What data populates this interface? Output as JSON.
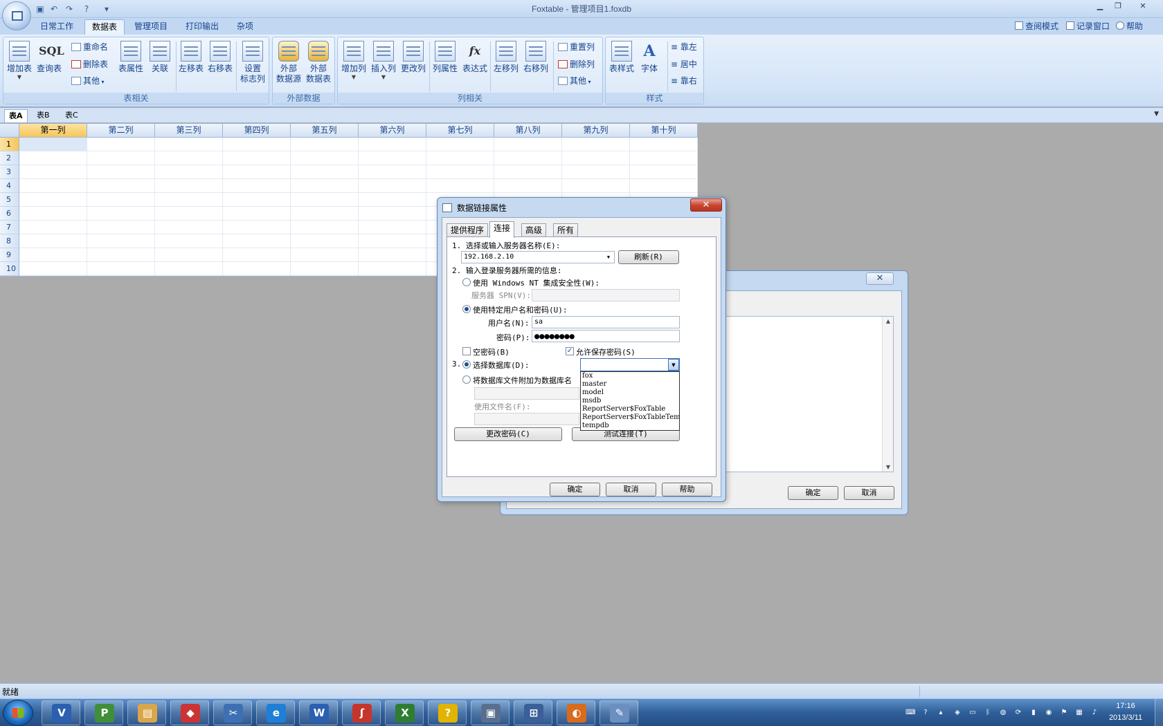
{
  "window": {
    "title": "Foxtable - 管理项目1.foxdb",
    "controls": [
      "minimize-icon",
      "restore-icon",
      "close-icon"
    ]
  },
  "ribbon_tabs": [
    "日常工作",
    "数据表",
    "管理项目",
    "打印输出",
    "杂项"
  ],
  "top_right": {
    "query_mode": "查阅模式",
    "record_window": "记录窗口",
    "help": "帮助"
  },
  "ribbon": {
    "table_group": {
      "label": "表相关",
      "add_table": "增加表",
      "query_table": "查询表",
      "sql_icon_text": "SQL",
      "rename": "重命名",
      "delete_table": "删除表",
      "other": "其他",
      "table_props": "表属性",
      "relation": "关联",
      "move_left": "左移表",
      "move_right": "右移表",
      "set_flag_col_1": "设置",
      "set_flag_col_2": "标志列"
    },
    "external_group": {
      "label": "外部数据",
      "ext_source_1": "外部",
      "ext_source_2": "数据源",
      "ext_table_1": "外部",
      "ext_table_2": "数据表"
    },
    "column_group": {
      "label": "列相关",
      "add_col": "增加列",
      "insert_col": "插入列",
      "change_col": "更改列",
      "col_props": "列属性",
      "expression": "表达式",
      "expr_icon_text": "fx",
      "move_col_left": "左移列",
      "move_col_right": "右移列",
      "reset_cols": "重置列",
      "delete_col": "删除列",
      "other": "其他"
    },
    "style_group": {
      "label": "样式",
      "table_style": "表样式",
      "font": "字体",
      "font_icon_text": "A",
      "align_left": "靠左",
      "align_center": "居中",
      "align_right": "靠右"
    }
  },
  "sheet_tabs": [
    "表A",
    "表B",
    "表C"
  ],
  "grid": {
    "columns": [
      "第一列",
      "第二列",
      "第三列",
      "第四列",
      "第五列",
      "第六列",
      "第七列",
      "第八列",
      "第九列",
      "第十列"
    ],
    "rows": [
      "1",
      "2",
      "3",
      "4",
      "5",
      "6",
      "7",
      "8",
      "9",
      "10"
    ]
  },
  "back_dialog": {
    "ok": "确定",
    "cancel": "取消"
  },
  "data_link_dialog": {
    "title": "数据链接属性",
    "tabs": [
      "提供程序",
      "连接",
      "高级",
      "所有"
    ],
    "step1_label": "1. 选择或输入服务器名称(E):",
    "server_value": "192.168.2.10",
    "refresh": "刷新(R)",
    "step2_label": "2. 输入登录服务器所需的信息:",
    "use_nt_security": "使用 Windows NT 集成安全性(W):",
    "server_spn_label": "服务器 SPN(V):",
    "use_specific_user": "使用特定用户名和密码(U):",
    "username_label": "用户名(N):",
    "username_value": "sa",
    "password_label": "密码(P):",
    "password_value": "●●●●●●●●",
    "blank_password": "空密码(B)",
    "allow_save_password": "允许保存密码(S)",
    "step3_number": "3.",
    "select_database": "选择数据库(D):",
    "attach_db_file": "将数据库文件附加为数据库名",
    "use_filename": "使用文件名(F):",
    "change_password": "更改密码(C)",
    "test_connection": "测试连接(T)",
    "database_options": [
      "fox",
      "master",
      "model",
      "msdb",
      "ReportServer$FoxTable",
      "ReportServer$FoxTableTempDB",
      "tempdb"
    ],
    "ok": "确定",
    "cancel": "取消",
    "help": "帮助"
  },
  "statusbar": {
    "text": "就绪"
  },
  "taskbar": {
    "apps": [
      "visio-icon",
      "project-icon",
      "explorer-icon",
      "paint-icon",
      "snipping-icon",
      "ie-icon",
      "word-icon",
      "foxtable-icon",
      "excel-icon",
      "help-icon",
      "remote-icon",
      "network-icon",
      "foxit-icon",
      "paint-brush-icon"
    ],
    "time": "17:16",
    "date": "2013/3/11"
  }
}
